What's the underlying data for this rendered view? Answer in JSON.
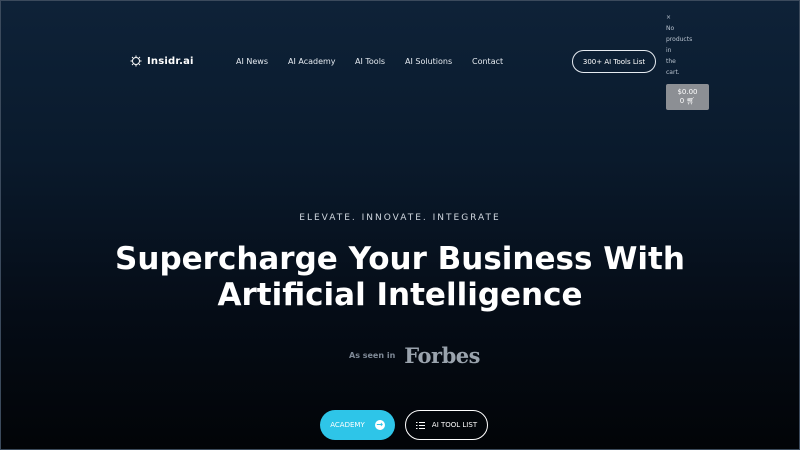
{
  "header": {
    "logo_text": "Insidr.ai",
    "logo_icon": "gear-sun-icon",
    "nav_items": [
      "AI News",
      "AI Academy",
      "AI Tools",
      "AI Solutions",
      "Contact"
    ],
    "tools_button": "300+ AI Tools List"
  },
  "cart_popup": {
    "close": "×",
    "message_lines": [
      "No",
      "products",
      "in",
      "the",
      "cart."
    ],
    "total": "$0.00",
    "count": "0",
    "cart_icon": "cart-icon"
  },
  "hero": {
    "eyebrow": "ELEVATE. INNOVATE. INTEGRATE",
    "headline_line1": "Supercharge Your Business With",
    "headline_line2": "Artificial Intelligence",
    "seen_label": "As seen in",
    "seen_logo": "Forbes",
    "cta_primary": "ACADEMY",
    "cta_secondary": "AI TOOL LIST"
  },
  "colors": {
    "accent": "#2ec5e8",
    "background_top": "#0e2238",
    "background_bottom": "#020407"
  }
}
